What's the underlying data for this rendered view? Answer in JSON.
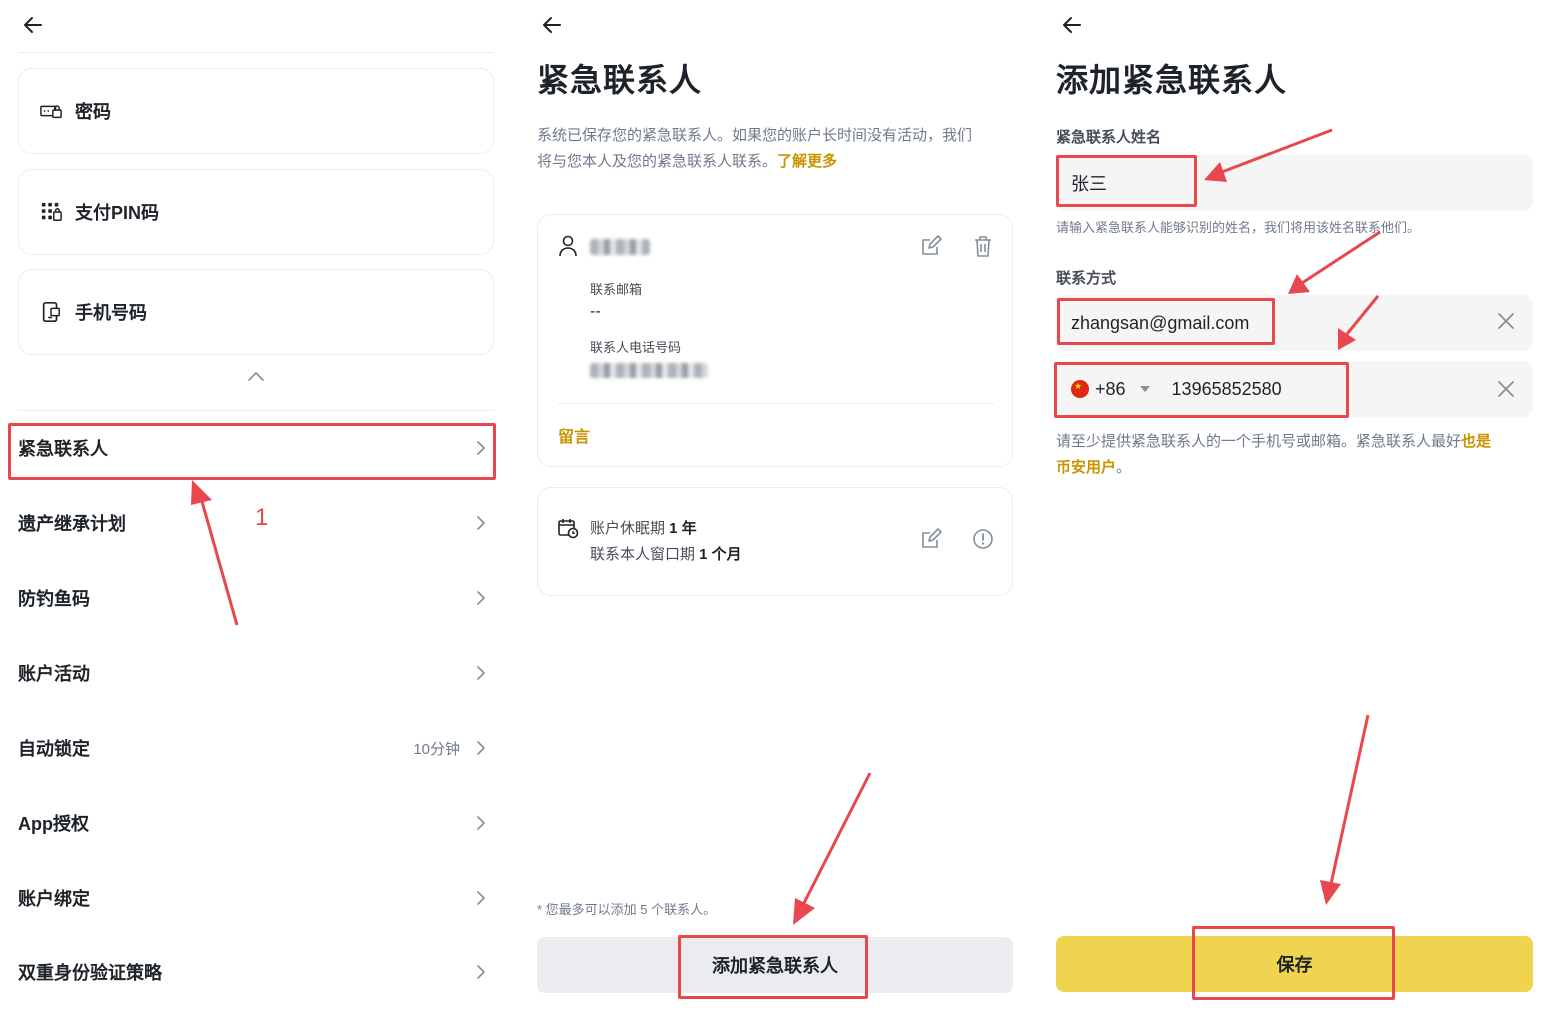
{
  "panel1": {
    "cards": [
      {
        "label": "密码",
        "icon": "password-icon"
      },
      {
        "label": "支付PIN码",
        "icon": "pin-keypad-icon"
      },
      {
        "label": "手机号码",
        "icon": "phone-icon"
      }
    ],
    "rows": [
      {
        "label": "紧急联系人",
        "value": ""
      },
      {
        "label": "遗产继承计划",
        "value": ""
      },
      {
        "label": "防钓鱼码",
        "value": ""
      },
      {
        "label": "账户活动",
        "value": ""
      },
      {
        "label": "自动锁定",
        "value": "10分钟"
      },
      {
        "label": "App授权",
        "value": ""
      },
      {
        "label": "账户绑定",
        "value": ""
      },
      {
        "label": "双重身份验证策略",
        "value": ""
      }
    ],
    "annotation_number": "1"
  },
  "panel2": {
    "title": "紧急联系人",
    "description_line1": "系统已保存您的紧急联系人。如果您的账户长时间没有活动，我们",
    "description_line2": "将与您本人及您的紧急联系人联系。",
    "learn_more": "了解更多",
    "contact": {
      "email_label": "联系邮箱",
      "email_value": "--",
      "phone_label": "联系人电话号码",
      "message_link": "留言"
    },
    "dormancy": {
      "line1_prefix": "账户休眠期 ",
      "line1_value": "1 年",
      "line2_prefix": "联系本人窗口期 ",
      "line2_value": "1 个月"
    },
    "footnote": "* 您最多可以添加 5 个联系人。",
    "add_button": "添加紧急联系人"
  },
  "panel3": {
    "title": "添加紧急联系人",
    "name_label": "紧急联系人姓名",
    "name_value": "张三",
    "name_hint": "请输入紧急联系人能够识别的姓名，我们将用该姓名联系他们。",
    "contact_label": "联系方式",
    "email_value": "zhangsan@gmail.com",
    "country_code": "+86",
    "phone_value": "13965852580",
    "contact_hint_line1_prefix": "请至少提供紧急联系人的一个手机号或邮箱。紧急联系人最好",
    "contact_hint_link_part1": "也是",
    "contact_hint_link_part2": "币安用户",
    "contact_hint_line2_suffix": "。",
    "save_button": "保存"
  },
  "colors": {
    "accent": "#f0d34e",
    "link": "#c99400",
    "annotation": "#e8474e",
    "text_primary": "#1e2329",
    "text_secondary": "#707a8a"
  }
}
